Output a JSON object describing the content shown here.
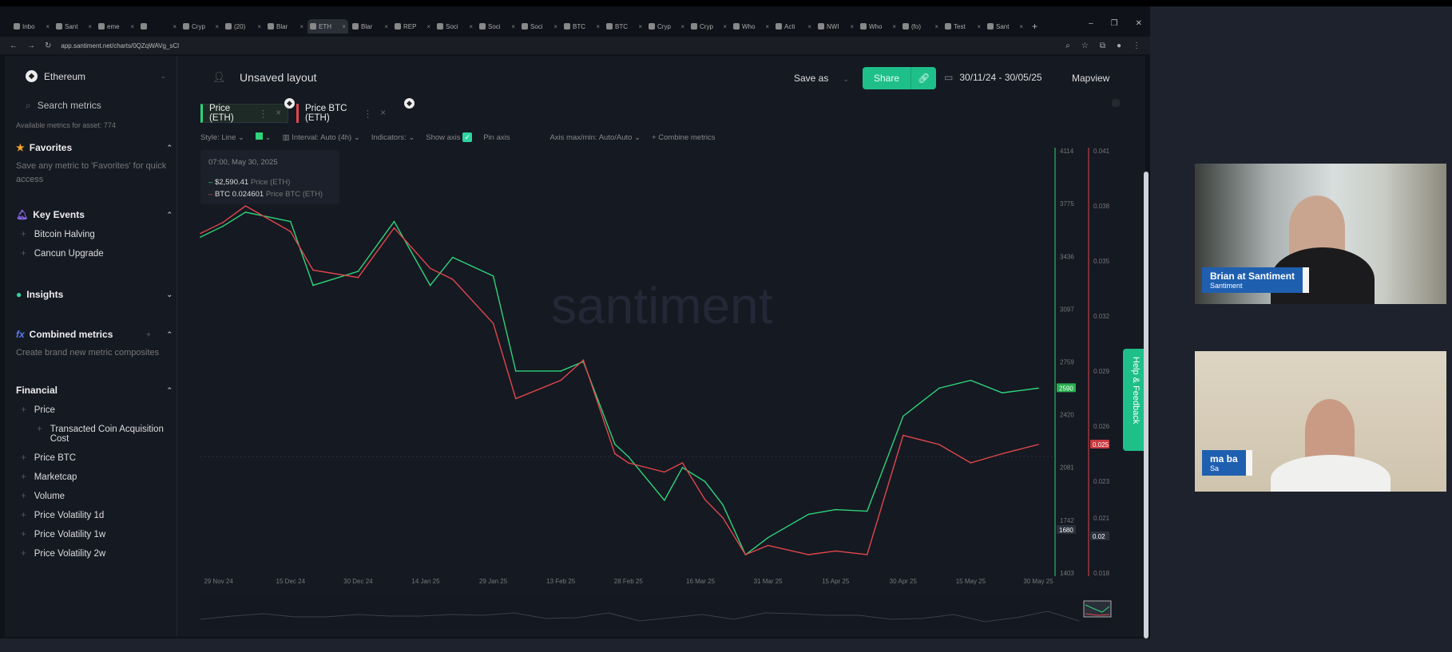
{
  "browser": {
    "tabs": [
      "Inbo",
      "Sant",
      "eme",
      "",
      "Cryp",
      "(20)",
      "Blar",
      "ETH",
      "Blar",
      "REP",
      "Soci",
      "Soci",
      "Soci",
      "BTC",
      "BTC",
      "Cryp",
      "Cryp",
      "Who",
      "Acti",
      "NWI",
      "Who",
      "(fo)",
      "Test",
      "Sant"
    ],
    "active_tab": 7,
    "url": "app.santiment.net/charts/0QZqWAVg_sCl"
  },
  "sidebar": {
    "asset": "Ethereum",
    "search_placeholder": "Search metrics",
    "available": "Available metrics for asset: 774",
    "favorites": {
      "title": "Favorites",
      "desc": "Save any metric to 'Favorites' for quick access"
    },
    "key_events": {
      "title": "Key Events",
      "items": [
        "Bitcoin Halving",
        "Cancun Upgrade"
      ]
    },
    "insights": {
      "title": "Insights"
    },
    "combined": {
      "title": "Combined metrics",
      "desc": "Create brand new metric composites"
    },
    "financial": {
      "title": "Financial",
      "items": [
        "Price",
        "Transacted Coin Acquisition Cost",
        "Price BTC",
        "Marketcap",
        "Volume",
        "Price Volatility 1d",
        "Price Volatility 1w",
        "Price Volatility 2w"
      ]
    }
  },
  "header": {
    "title": "Unsaved layout",
    "save_as": "Save as",
    "share": "Share",
    "date_range": "30/11/24 - 30/05/25",
    "mapview": "Mapview"
  },
  "metrics": [
    {
      "label": "Price (ETH)",
      "color": "#2ed47a"
    },
    {
      "label": "Price BTC (ETH)",
      "color": "#e0474c"
    }
  ],
  "toolbar": {
    "style": "Style: Line",
    "interval": "Interval: Auto (4h)",
    "indicators": "Indicators:",
    "show_axis": "Show axis",
    "pin_axis": "Pin axis",
    "axis_maxmin": "Axis max/min: Auto/Auto",
    "combine": "+ Combine metrics"
  },
  "tooltip": {
    "time": "07:00, May 30, 2025",
    "eth_value": "$2,590.41",
    "eth_name": "Price (ETH)",
    "btc_value": "BTC 0.024601",
    "btc_name": "Price BTC (ETH)"
  },
  "watermark": "santiment",
  "help": "Help & Feedback",
  "chart_data": {
    "type": "line",
    "x_start": "2024-11-29",
    "x_ticks": [
      "29 Nov 24",
      "15 Dec 24",
      "30 Dec 24",
      "14 Jan 25",
      "29 Jan 25",
      "13 Feb 25",
      "28 Feb 25",
      "16 Mar 25",
      "31 Mar 25",
      "15 Apr 25",
      "30 Apr 25",
      "15 May 25",
      "30 May 25"
    ],
    "x_days": [
      -4,
      1,
      6,
      16,
      21,
      31,
      39,
      47,
      52,
      61,
      66,
      76,
      81,
      88,
      91,
      99,
      103,
      108,
      112,
      117,
      122,
      131,
      137,
      144,
      152,
      160,
      167,
      174,
      182
    ],
    "series": [
      {
        "name": "Price (ETH)",
        "color": "#2ed47a",
        "axis": "left",
        "values": [
          3560,
          3630,
          3720,
          3660,
          3250,
          3340,
          3660,
          3250,
          3430,
          3310,
          2700,
          2700,
          2760,
          2230,
          2150,
          1870,
          2080,
          1990,
          1840,
          1520,
          1630,
          1780,
          1810,
          1800,
          2410,
          2590,
          2640,
          2560,
          2590
        ]
      },
      {
        "name": "Price BTC (ETH)",
        "color": "#e0474c",
        "axis": "right",
        "values": [
          0.0365,
          0.0371,
          0.038,
          0.0366,
          0.0345,
          0.0341,
          0.0368,
          0.0346,
          0.034,
          0.0316,
          0.0275,
          0.0285,
          0.0296,
          0.0245,
          0.024,
          0.0235,
          0.024,
          0.022,
          0.021,
          0.019,
          0.0195,
          0.019,
          0.0192,
          0.019,
          0.0255,
          0.025,
          0.024,
          0.0245,
          0.025
        ]
      }
    ],
    "left_axis": {
      "ticks": [
        "4114",
        "3775",
        "3436",
        "3097",
        "2759",
        "2420",
        "2081",
        "1742",
        "1403"
      ],
      "range": [
        1403,
        4114
      ],
      "current": "2590",
      "marker": "1680"
    },
    "right_axis": {
      "ticks": [
        "0.041",
        "0.038",
        "0.035",
        "0.032",
        "0.029",
        "0.026",
        "0.023",
        "0.021",
        "0.018"
      ],
      "range": [
        0.018,
        0.041
      ],
      "current": "0.025",
      "marker": "0.02"
    }
  },
  "participants": [
    {
      "name": "Brian at Santiment",
      "org": "Santiment"
    },
    {
      "name": "ma ba",
      "org": "Sa"
    }
  ]
}
